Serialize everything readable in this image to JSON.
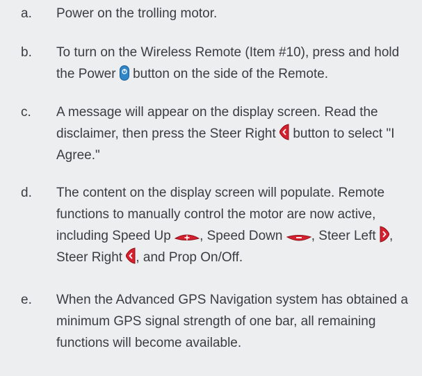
{
  "steps": [
    {
      "letter": "a.",
      "text": "Power on the trolling motor."
    },
    {
      "letter": "b.",
      "text_1": "To turn on the Wireless Remote (Item #10), press and hold the Power",
      "icon_1": "power-button-icon",
      "text_2": "button on the side of the Remote."
    },
    {
      "letter": "c.",
      "text_1": "A message will appear on the display screen. Read the disclaimer, then press the Steer Right",
      "icon_1": "steer-right-button-icon",
      "text_2": "button to select \"I Agree.\""
    },
    {
      "letter": "d.",
      "text_1": "The content on the display screen will populate. Remote functions to manually control the motor are now active, including Speed Up",
      "icon_1": "speed-up-button-icon",
      "text_2": ", Speed Down",
      "icon_2": "speed-down-button-icon",
      "text_3": ", Steer Left",
      "icon_3": "steer-left-button-icon",
      "text_4": ", Steer Right",
      "icon_4": "steer-right-button-icon",
      "text_5": ", and Prop On/Off."
    },
    {
      "letter": "e.",
      "text": "When the Advanced GPS Navigation system has obtained a minimum GPS signal strength of one bar, all remaining functions will become available."
    }
  ],
  "colors": {
    "background": "#eceeef",
    "text": "#3a3d40",
    "power_button": "#2f86c8",
    "steer_button": "#d6202e",
    "speed_button": "#d6202e"
  }
}
